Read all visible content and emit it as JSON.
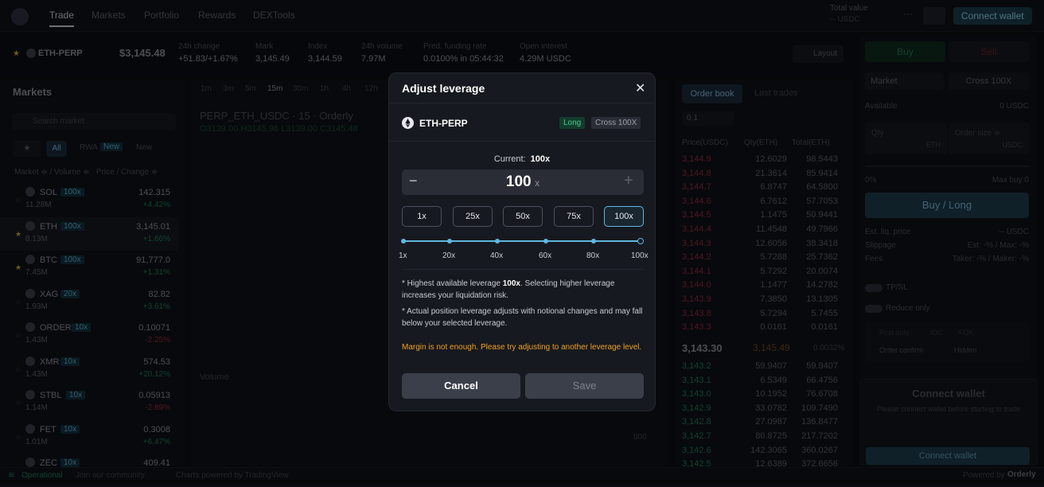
{
  "nav": {
    "items": [
      "Trade",
      "Markets",
      "Portfolio",
      "Rewards",
      "DEXTools"
    ],
    "total_value_label": "Total value",
    "total_value": "-- USDC",
    "connect_wallet": "Connect wallet"
  },
  "ticker": {
    "symbol": "ETH-PERP",
    "price": "$3,145.48",
    "stats": [
      {
        "label": "24h change",
        "value": "+51.83/+1.67%"
      },
      {
        "label": "Mark",
        "value": "3,145.49"
      },
      {
        "label": "Index",
        "value": "3,144.59"
      },
      {
        "label": "24h volume",
        "value": "7.97M"
      },
      {
        "label": "Pred. funding rate",
        "value": "0.0100% in 05:44:32"
      },
      {
        "label": "Open interest",
        "value": "4.29M USDC"
      }
    ],
    "layout": "Layout"
  },
  "markets": {
    "title": "Markets",
    "search_placeholder": "Search market",
    "filters": [
      "All",
      "RWA",
      "New",
      "New"
    ],
    "headers": "Market ≑ / Volume ≑   Price / Change ≑",
    "rows": [
      {
        "sym": "SOL",
        "lev": "100x",
        "vol": "11.28M",
        "px": "142.315",
        "ch": "+4.42%",
        "dir": "up"
      },
      {
        "sym": "ETH",
        "lev": "100x",
        "vol": "8.13M",
        "px": "3,145.01",
        "ch": "+1.66%",
        "dir": "up"
      },
      {
        "sym": "BTC",
        "lev": "100x",
        "vol": "7.45M",
        "px": "91,777.0",
        "ch": "+1.31%",
        "dir": "up"
      },
      {
        "sym": "XAG",
        "lev": "20x",
        "vol": "1.93M",
        "px": "82.82",
        "ch": "+3.61%",
        "dir": "up"
      },
      {
        "sym": "ORDER",
        "lev": "10x",
        "vol": "1.43M",
        "px": "0.10071",
        "ch": "-2.25%",
        "dir": "dn"
      },
      {
        "sym": "XMR",
        "lev": "10x",
        "vol": "1.43M",
        "px": "574.53",
        "ch": "+20.12%",
        "dir": "up"
      },
      {
        "sym": "STBL",
        "lev": "10x",
        "vol": "1.14M",
        "px": "0.05913",
        "ch": "-2.89%",
        "dir": "dn"
      },
      {
        "sym": "FET",
        "lev": "10x",
        "vol": "1.01M",
        "px": "0.3008",
        "ch": "+6.47%",
        "dir": "up"
      },
      {
        "sym": "ZEC",
        "lev": "10x",
        "vol": "",
        "px": "409.41",
        "ch": "",
        "dir": "up"
      }
    ]
  },
  "chart": {
    "intervals": [
      "1m",
      "3m",
      "5m",
      "15m",
      "30m",
      "1h",
      "4h",
      "12h"
    ],
    "title": "PERP_ETH_USDC · 15 · Orderly",
    "ohlc": "O3139.00 H3145.96 L3139.00 C3145.48",
    "volume": "Volume",
    "axis_600": "800"
  },
  "orderbook": {
    "tabs": [
      "Order book",
      "Last trades"
    ],
    "tick": "0.1",
    "headers": [
      "Price(USDC)",
      "Qty(ETH)",
      "Total(ETH)"
    ],
    "asks": [
      [
        "3,144.9",
        "12.6029",
        "98.5443"
      ],
      [
        "3,144.8",
        "21.3614",
        "85.9414"
      ],
      [
        "3,144.7",
        "6.8747",
        "64.5800"
      ],
      [
        "3,144.6",
        "6.7612",
        "57.7053"
      ],
      [
        "3,144.5",
        "1.1475",
        "50.9441"
      ],
      [
        "3,144.4",
        "11.4548",
        "49.7966"
      ],
      [
        "3,144.3",
        "12.6056",
        "38.3418"
      ],
      [
        "3,144.2",
        "5.7288",
        "25.7362"
      ],
      [
        "3,144.1",
        "5.7292",
        "20.0074"
      ],
      [
        "3,144.0",
        "1.1477",
        "14.2782"
      ],
      [
        "3,143.9",
        "7.3850",
        "13.1305"
      ],
      [
        "3,143.8",
        "5.7294",
        "5.7455"
      ],
      [
        "3,143.3",
        "0.0161",
        "0.0161"
      ]
    ],
    "mid_price": "3,143.30",
    "mark": "3,145.49",
    "spread": "0.0032%",
    "bids": [
      [
        "3,143.2",
        "59.9407",
        "59.9407"
      ],
      [
        "3,143.1",
        "6.5349",
        "66.4756"
      ],
      [
        "3,143.0",
        "10.1952",
        "76.6708"
      ],
      [
        "3,142.9",
        "33.0782",
        "109.7490"
      ],
      [
        "3,142.8",
        "27.0987",
        "136.8477"
      ],
      [
        "3,142.7",
        "80.8725",
        "217.7202"
      ],
      [
        "3,142.6",
        "142.3065",
        "360.0267"
      ],
      [
        "3,142.5",
        "12.6389",
        "372.6656"
      ]
    ]
  },
  "order": {
    "buy": "Buy",
    "sell": "Sell",
    "market": "Market",
    "cross": "Cross 100X",
    "available": "Available",
    "available_val": "0 USDC",
    "qty": "Qty",
    "qty_unit": "ETH",
    "size": "Order size ≑",
    "size_unit": "USDC",
    "min": "0%",
    "max": "Max buy 0",
    "submit": "Buy / Long",
    "rows": [
      [
        "Est. liq. price",
        "-- USDC"
      ],
      [
        "Slippage",
        "Est: -% / Max: -%"
      ],
      [
        "Fees",
        "Taker: -% / Maker: -%"
      ]
    ],
    "tpsl": "TP/SL",
    "reduce": "Reduce only",
    "post": "Post only",
    "ioc": "IOC",
    "fok": "FOK",
    "confirm": "Order confirm",
    "hidden": "Hidden",
    "cw_title": "Connect wallet",
    "cw_desc": "Please connect wallet before starting to trade",
    "cw_btn": "Connect wallet"
  },
  "footer": {
    "status": "Operational",
    "community": "Join our community",
    "powered_chart": "Charts powered by TradingView",
    "powered": "Powered by",
    "brand": "Orderly"
  },
  "modal": {
    "title": "Adjust leverage",
    "symbol": "ETH-PERP",
    "side": "Long",
    "mode": "Cross 100X",
    "current_label": "Current:",
    "current_value": "100x",
    "leverage": "100",
    "unit": "x",
    "presets": [
      "1x",
      "25x",
      "50x",
      "75x",
      "100x"
    ],
    "ticks": [
      "1x",
      "20x",
      "40x",
      "60x",
      "80x",
      "100x"
    ],
    "slider_value": 100,
    "note1_pre": "* Highest available leverage ",
    "note1_bold": "100x",
    "note1_post": ". Selecting higher leverage increases your liquidation risk.",
    "note2": "* Actual position leverage adjusts with notional changes and may fall below your selected leverage.",
    "warning": "Margin is not enough. Please try adjusting to another leverage level.",
    "cancel": "Cancel",
    "save": "Save"
  }
}
